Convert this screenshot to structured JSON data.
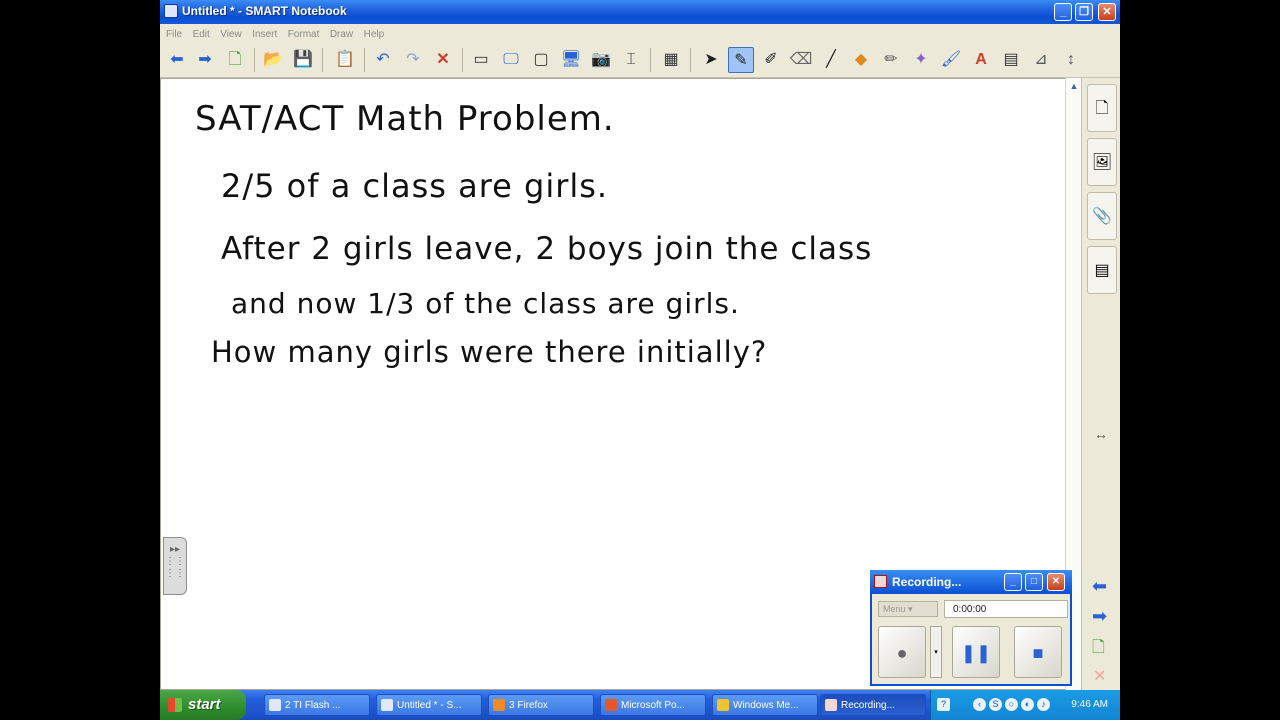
{
  "window": {
    "title": "Untitled * - SMART Notebook"
  },
  "menu": [
    "File",
    "Edit",
    "View",
    "Insert",
    "Format",
    "Draw",
    "Help"
  ],
  "canvas": {
    "lines": [
      "SAT/ACT Math Problem.",
      "2/5 of a class are girls.",
      "After 2 girls leave, 2 boys join the class",
      "and now 1/3 of the class are girls.",
      "How many girls were there initially?"
    ]
  },
  "recorder": {
    "title": "Recording...",
    "menu_label": "Menu",
    "time": "0:00:00"
  },
  "taskbar": {
    "start": "start",
    "tasks": [
      "2 TI Flash ...",
      "Untitled * - S...",
      "3 Firefox",
      "Microsoft Po...",
      "Windows Me...",
      "Recording..."
    ],
    "clock": "9:46 AM"
  },
  "colors": {
    "titlebar": "#0a4fd1",
    "taskbar": "#245edb",
    "start": "#2e8c2b",
    "canvas": "#ffffff"
  }
}
